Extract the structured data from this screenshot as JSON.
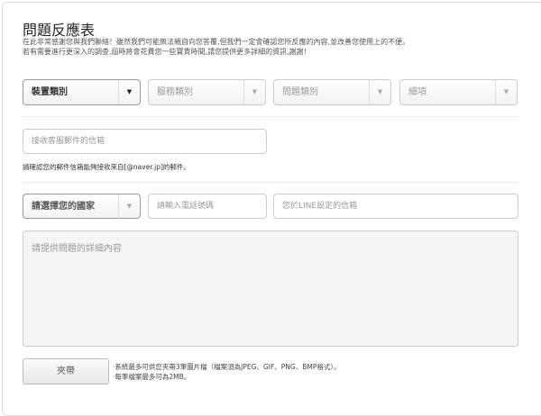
{
  "title": "問題反應表",
  "intro": [
    "在此非常感謝您與我們聯絡！雖然我們可能無法親自向您答覆,但我們一定會確認您所反應的內容,並改善您使用上的不便。",
    "若有需要進行更深入的調查,屆時將會花費您一些寶貴時間,請您提供更多詳細的資訊,謝謝！"
  ],
  "selects": [
    {
      "label": "裝置類別"
    },
    {
      "label": "服務類別"
    },
    {
      "label": "問題類別"
    },
    {
      "label": "細項"
    }
  ],
  "email_placeholder": "接收客服郵件的信箱",
  "email_note": "請確認您的郵件信箱能夠接收來自[@naver.jp]的郵件。",
  "country_select": "請選擇您的國家",
  "phone_placeholder": "請輸入電話號碼",
  "line_placeholder": "您於LINE設定的信箱",
  "details_placeholder": "請提供問題的詳細內容",
  "attach_button": "夾帶",
  "attach_notes": [
    "‧系統最多可供您夾帶3筆圖片檔（檔案須為JPEG、GIF、PNG、BMP格式）。",
    "‧每筆檔案最多可為2MB。"
  ]
}
